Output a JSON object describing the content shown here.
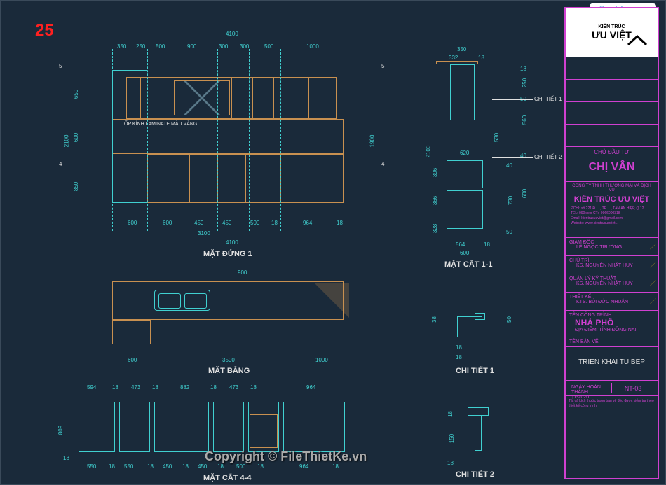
{
  "page_number": "25",
  "watermark": {
    "file": "File",
    "thiet": "Thiet",
    "ke": "Ke",
    "ext": ".vn"
  },
  "copyright": "Copyright © FileThietKe.vn",
  "views": {
    "elevation1": {
      "label": "MẶT ĐỨNG 1",
      "note": "ỐP KÍNH LAMINATE MÀU VÀNG"
    },
    "plan": {
      "label": "MẶT BẰNG"
    },
    "section44": {
      "label": "MẶT CẮT 4-4"
    },
    "section11": {
      "label": "MẶT CẮT 1-1"
    },
    "detail1": {
      "label": "CHI TIẾT 1"
    },
    "detail2": {
      "label": "CHI TIẾT 2"
    },
    "detail1_leader": "CHI TIẾT 1",
    "detail2_leader": "CHI TIẾT 2"
  },
  "dims": {
    "elev1_top_total": "4100",
    "elev1_top": [
      "350",
      "250",
      "500",
      "900",
      "300",
      "300",
      "500",
      "1000"
    ],
    "elev1_bot_total": "3100",
    "elev1_bot": [
      "600",
      "600",
      "450",
      "450",
      "500",
      "18",
      "964",
      "18"
    ],
    "elev1_bot2": "4100",
    "elev1_left": [
      "650",
      "600",
      "850"
    ],
    "elev1_left_total": "2100",
    "elev1_right": "1900",
    "sec11_top": [
      "350",
      "332",
      "18"
    ],
    "sec11_right": [
      "18",
      "250",
      "50",
      "560",
      "40",
      "600"
    ],
    "sec11_right2": [
      "530",
      "620"
    ],
    "sec11_right3_total": "2100",
    "sec11_left": [
      "396",
      "366",
      "328"
    ],
    "sec11_left2": [
      "40",
      "730",
      "50"
    ],
    "sec11_bot": [
      "564",
      "18",
      "600"
    ],
    "plan_top": [
      "900"
    ],
    "plan_bot": [
      "600",
      "3500",
      "1000"
    ],
    "sec44_top": [
      "594",
      "18",
      "473",
      "18",
      "882",
      "18",
      "473",
      "18",
      "964"
    ],
    "sec44_bot": [
      "550",
      "18",
      "550",
      "18",
      "450",
      "18",
      "450",
      "18",
      "500",
      "18",
      "964",
      "18"
    ],
    "sec44_left": [
      "809",
      "18"
    ],
    "det1_dims": [
      "38",
      "18",
      "18"
    ],
    "det1_right": "50",
    "det2_dims": [
      "18",
      "150",
      "18"
    ]
  },
  "title_block": {
    "logo_line1": "KIẾN TRÚC",
    "logo_line2": "ƯU VIỆT",
    "client_label": "CHỦ ĐẦU TƯ",
    "client_name": "CHỊ VÂN",
    "company_sub": "CÔNG TY TNHH THƯƠNG MẠI VÀ DỊCH VỤ",
    "company_name": "KIẾN TRÚC ƯU VIỆT",
    "company_addr": "ĐCHỈ: số 221 Đ. ..., TP. ..., TÂN ÂN HIỆP, Q.12",
    "company_tel": "TEL:    090xxxx-CTx-0966000318",
    "company_email": "Email:   kientrucuuviet@gmail.com",
    "company_web": "Website:  www.kientrucuuviet...",
    "gd_label": "GIÁM ĐỐC",
    "gd_val": "LÊ NGỌC TRƯỜNG",
    "ct_label": "CHỦ TRÌ",
    "ct_val": "KS. NGUYỄN NHẬT HUY",
    "ql_label": "QUẢN LÝ KỸ THUẬT",
    "ql_val": "KS. NGUYỄN NHẬT HUY",
    "tk_label": "THIẾT KẾ",
    "tk_val": "KTS. BÙI ĐỨC NHUẬN",
    "proj_label": "TÊN CÔNG TRÌNH",
    "proj_name": "NHÀ PHỐ",
    "loc_label": "ĐỊA ĐIỂM:",
    "loc_val": "TỈNH ĐỒNG NAI",
    "drawing_label": "TÊN BẢN VẼ",
    "drawing_name": "TRIEN KHAI TU BEP",
    "date_label": "NGÀY HOÀN THÀNH",
    "date_val": "11-2020",
    "sheet_no": "NT-03",
    "note": "Tất cả kích thước trong bản vẽ đều được kiểm tra theo thiết kế công trình"
  }
}
